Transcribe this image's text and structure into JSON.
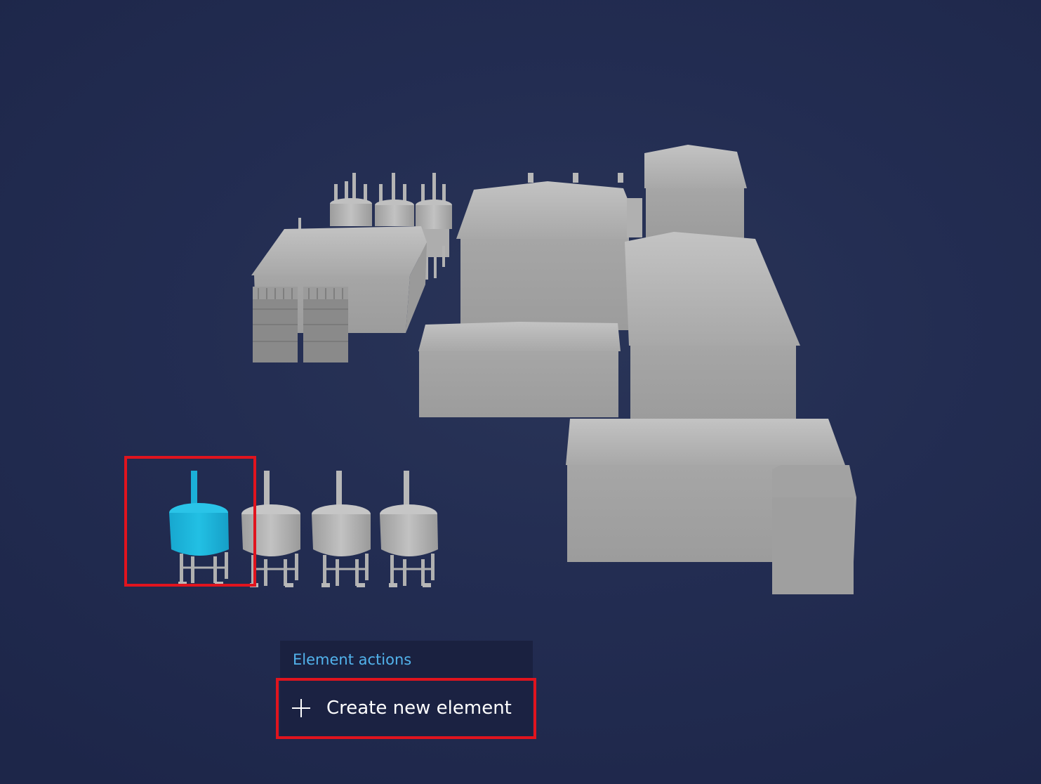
{
  "scene": {
    "description_colors": {
      "background": "#232d52",
      "building": "#a9a9a9",
      "selected": "#1eb7dc",
      "highlight": "#e0141e"
    }
  },
  "actions_panel": {
    "title": "Element actions",
    "create_button": {
      "icon": "plus-icon",
      "label": "Create new element"
    }
  }
}
